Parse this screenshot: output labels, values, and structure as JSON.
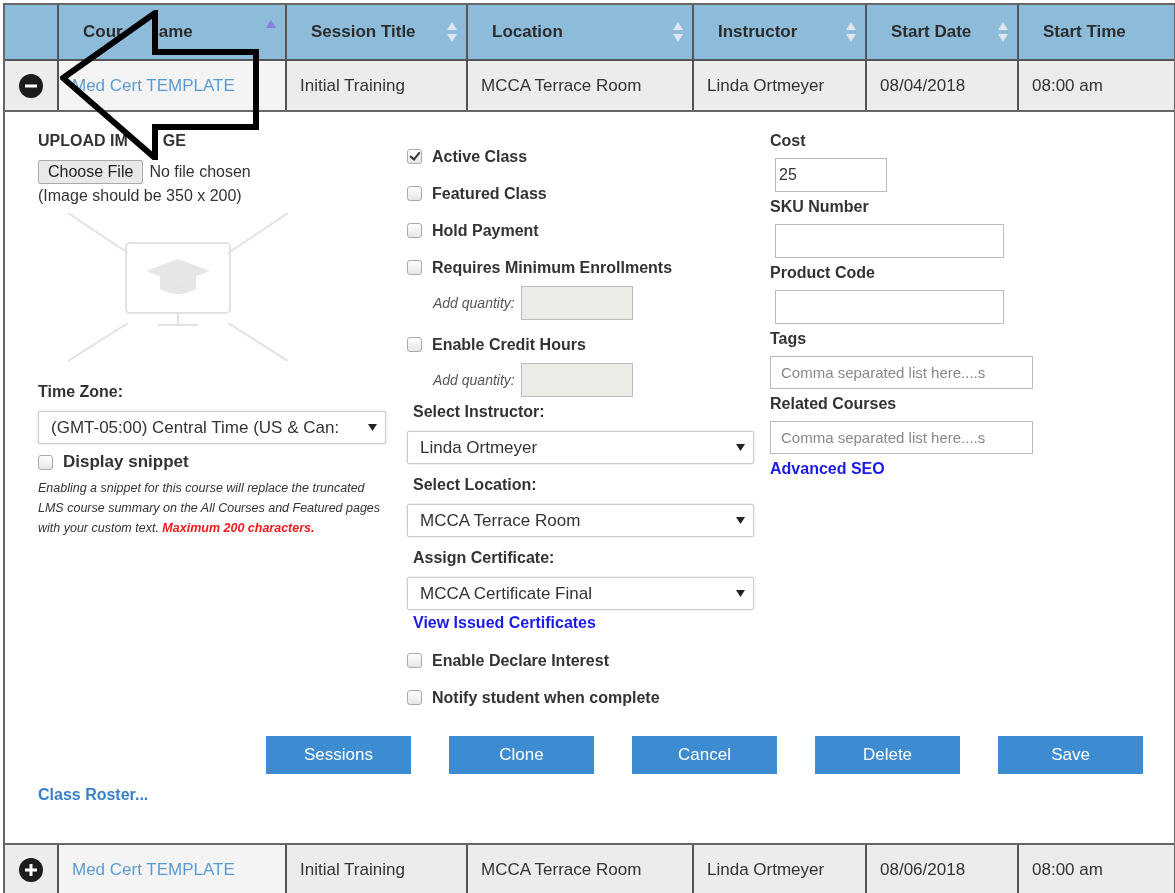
{
  "table": {
    "columns": [
      {
        "label": "Cour",
        "label_rest": "ame",
        "sorted": true
      },
      {
        "label": "Session Title",
        "sorted": false
      },
      {
        "label": "Location",
        "sorted": false
      },
      {
        "label": "Instructor",
        "sorted": false
      },
      {
        "label": "Start Date",
        "sorted": false
      },
      {
        "label": "Start Time"
      }
    ],
    "rows": [
      {
        "expanded": true,
        "cells": [
          "Med Cert TEMPLATE",
          "Initial Training",
          "MCCA Terrace Room",
          "Linda Ortmeyer",
          "08/04/2018",
          "08:00 am"
        ]
      },
      {
        "expanded": false,
        "cells": [
          "Med Cert TEMPLATE",
          "Initial Training",
          "MCCA Terrace Room",
          "Linda Ortmeyer",
          "08/06/2018",
          "08:00 am"
        ]
      }
    ]
  },
  "detail": {
    "upload": {
      "heading": "UPLOAD IM",
      "heading_rest": "GE",
      "button": "Choose File",
      "status": "No file chosen",
      "hint": "(Image should be 350 x 200)"
    },
    "time_zone": {
      "label": "Time Zone:",
      "value": "(GMT-05:00) Central Time (US & Can:"
    },
    "snippet": {
      "label": "Display snippet",
      "checked": false,
      "note": "Enabling a snippet for this course will replace the truncated LMS course summary on the All Courses and Featured pages with your custom text. **Maximum 200 characters.**"
    },
    "options": [
      {
        "kind": "checkbox",
        "label": "Active Class",
        "checked": true
      },
      {
        "kind": "checkbox",
        "label": "Featured Class",
        "checked": false
      },
      {
        "kind": "checkbox",
        "label": "Hold Payment",
        "checked": false
      },
      {
        "kind": "checkbox",
        "label": "Requires Minimum Enrollments",
        "checked": false
      },
      {
        "kind": "quantity",
        "label": "Add quantity:"
      },
      {
        "kind": "checkbox",
        "label": "Enable Credit Hours",
        "checked": false
      },
      {
        "kind": "quantity",
        "label": "Add quantity:"
      },
      {
        "kind": "select",
        "label": "Select Instructor:",
        "value": "Linda Ortmeyer"
      },
      {
        "kind": "select",
        "label": "Select Location:",
        "value": "MCCA Terrace Room"
      },
      {
        "kind": "select",
        "label": "Assign Certificate:",
        "value": "MCCA Certificate Final"
      },
      {
        "kind": "link",
        "label": "View Issued Certificates"
      },
      {
        "kind": "checkbox",
        "label": "Enable Declare Interest",
        "checked": false
      },
      {
        "kind": "checkbox",
        "label": "Notify student when complete",
        "checked": false
      }
    ],
    "fields": [
      {
        "kind": "short",
        "label": "Cost",
        "value": "25"
      },
      {
        "kind": "medium",
        "label": "SKU Number"
      },
      {
        "kind": "medium",
        "label": "Product Code"
      },
      {
        "kind": "wide",
        "label": "Tags",
        "placeholder": "Comma separated list here....s"
      },
      {
        "kind": "wide",
        "label": "Related Courses",
        "placeholder": "Comma separated list here....s"
      }
    ],
    "seo_link": "Advanced SEO",
    "buttons": [
      "Sessions",
      "Clone",
      "Cancel",
      "Delete",
      "Save"
    ],
    "roster_link": "Class Roster..."
  }
}
